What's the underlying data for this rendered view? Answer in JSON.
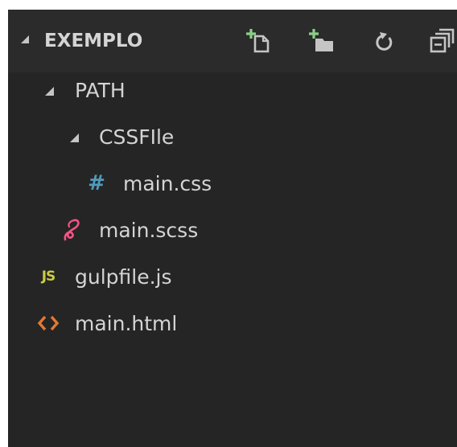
{
  "explorer": {
    "title": "EXEMPLO",
    "actions": [
      {
        "name": "new-file",
        "label": "New File"
      },
      {
        "name": "new-folder",
        "label": "New Folder"
      },
      {
        "name": "refresh",
        "label": "Refresh"
      },
      {
        "name": "collapse-all",
        "label": "Collapse All"
      }
    ]
  },
  "tree": {
    "path_folder": "PATH",
    "cssfile_folder": "CSSFIle",
    "main_css": "main.css",
    "main_scss": "main.scss",
    "gulpfile": "gulpfile.js",
    "main_html": "main.html"
  },
  "icons": {
    "css": "#",
    "js": "JS"
  },
  "colors": {
    "background": "#252526",
    "header": "#2b2b2c",
    "text": "#d4d4d4",
    "new_item_plus": "#89d185",
    "css": "#519aba",
    "scss": "#f55385",
    "js": "#cbcb41",
    "html": "#e37933"
  }
}
